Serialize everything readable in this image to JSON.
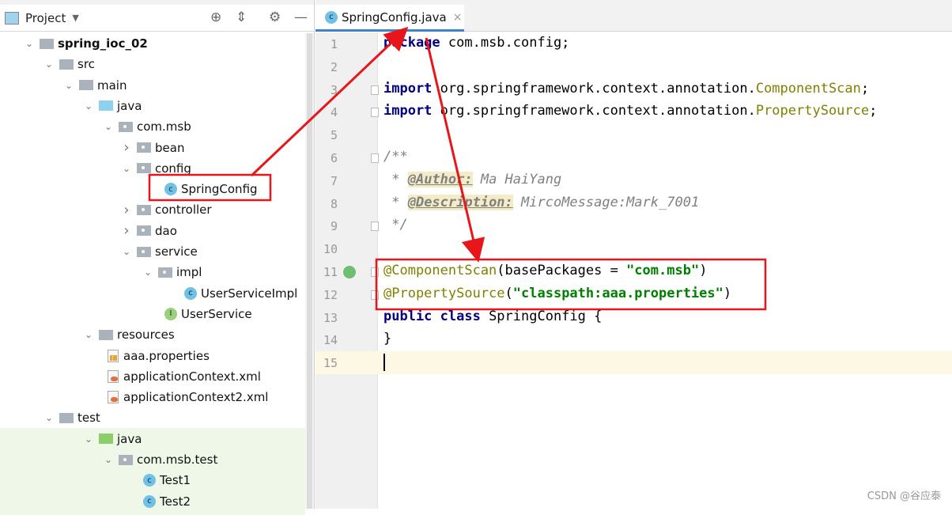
{
  "project_panel": {
    "title": "Project",
    "icons": [
      "locate-icon",
      "collapse-all-icon",
      "gear-icon",
      "minimize-icon"
    ]
  },
  "tree": [
    {
      "label": "spring_ioc_02",
      "level": 0,
      "chev": "down",
      "icon": "module",
      "bold": true
    },
    {
      "label": "src",
      "level": 1,
      "chev": "down",
      "icon": "folder"
    },
    {
      "label": "main",
      "level": 2,
      "chev": "down",
      "icon": "folder"
    },
    {
      "label": "java",
      "level": 3,
      "chev": "down",
      "icon": "folder-blue"
    },
    {
      "label": "com.msb",
      "level": 4,
      "chev": "down",
      "icon": "package"
    },
    {
      "label": "bean",
      "level": 5,
      "chev": "right",
      "icon": "package"
    },
    {
      "label": "config",
      "level": 5,
      "chev": "down",
      "icon": "package"
    },
    {
      "label": "SpringConfig",
      "level": 6,
      "chev": "",
      "icon": "class"
    },
    {
      "label": "controller",
      "level": 5,
      "chev": "right",
      "icon": "package"
    },
    {
      "label": "dao",
      "level": 5,
      "chev": "right",
      "icon": "package"
    },
    {
      "label": "service",
      "level": 5,
      "chev": "down",
      "icon": "package"
    },
    {
      "label": "impl",
      "level": 6,
      "chev": "down",
      "icon": "package"
    },
    {
      "label": "UserServiceImpl",
      "level": 7,
      "chev": "",
      "icon": "class"
    },
    {
      "label": "UserService",
      "level": 6,
      "chev": "",
      "icon": "interface"
    },
    {
      "label": "resources",
      "level": 3,
      "chev": "down",
      "icon": "folder-res"
    },
    {
      "label": "aaa.properties",
      "level": 4,
      "chev": "",
      "icon": "properties"
    },
    {
      "label": "applicationContext.xml",
      "level": 4,
      "chev": "",
      "icon": "xml"
    },
    {
      "label": "applicationContext2.xml",
      "level": 4,
      "chev": "",
      "icon": "xml"
    },
    {
      "label": "test",
      "level": 1,
      "chev": "down",
      "icon": "folder"
    },
    {
      "label": "java",
      "level": 3,
      "chev": "down",
      "icon": "folder-green"
    },
    {
      "label": "com.msb.test",
      "level": 4,
      "chev": "down",
      "icon": "package"
    },
    {
      "label": "Test1",
      "level": 5,
      "chev": "",
      "icon": "test-class"
    },
    {
      "label": "Test2",
      "level": 5,
      "chev": "",
      "icon": "test-class"
    }
  ],
  "editor": {
    "tab": {
      "label": "SpringConfig.java",
      "close": "×"
    },
    "current_line": 15,
    "lines": [
      [
        [
          "package",
          "kw"
        ],
        [
          " com.msb.config;",
          ""
        ]
      ],
      [],
      [
        [
          "import",
          "kw"
        ],
        [
          " org.springframework.context.annotation.",
          ""
        ],
        [
          "ComponentScan",
          "ann"
        ],
        [
          ";",
          ""
        ]
      ],
      [
        [
          "import",
          "kw"
        ],
        [
          " org.springframework.context.annotation.",
          ""
        ],
        [
          "PropertySource",
          "ann"
        ],
        [
          ";",
          ""
        ]
      ],
      [],
      [
        [
          "/**",
          "cm"
        ]
      ],
      [
        [
          " * ",
          "cm"
        ],
        [
          "@Author:",
          "tag"
        ],
        [
          " Ma HaiYang",
          "cm"
        ]
      ],
      [
        [
          " * ",
          "cm"
        ],
        [
          "@Description:",
          "tag"
        ],
        [
          " MircoMessage:Mark_7001",
          "cm"
        ]
      ],
      [
        [
          " */",
          "cm"
        ]
      ],
      [],
      [
        [
          "@ComponentScan",
          "ann"
        ],
        [
          "(basePackages = ",
          ""
        ],
        [
          "\"com.msb\"",
          "str"
        ],
        [
          ")",
          ""
        ]
      ],
      [
        [
          "@PropertySource",
          "ann"
        ],
        [
          "(",
          ""
        ],
        [
          "\"classpath:aaa.properties\"",
          "str"
        ],
        [
          ")",
          ""
        ]
      ],
      [
        [
          "public class",
          "kw"
        ],
        [
          " SpringConfig {",
          ""
        ]
      ],
      [
        [
          "}",
          ""
        ]
      ],
      []
    ]
  },
  "watermark": "CSDN @谷应泰",
  "annotation_color": "#e8161b"
}
